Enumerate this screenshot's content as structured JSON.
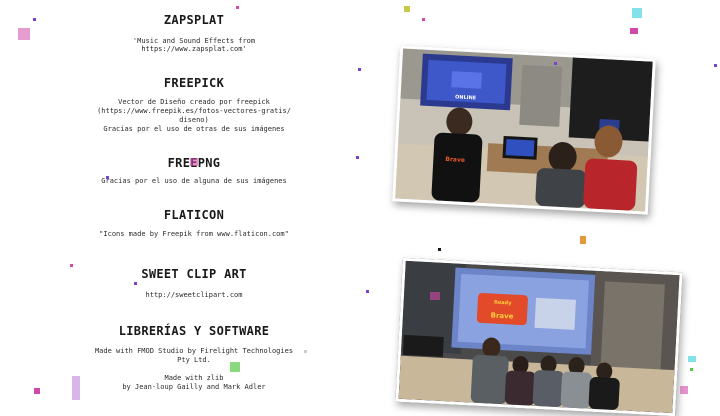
{
  "credits": {
    "zapsplat": {
      "heading": "ZAPSPLAT",
      "lines": [
        "'Music and Sound Effects from",
        "https://www.zapsplat.com'"
      ]
    },
    "freepick": {
      "heading": "FREEPICK",
      "lines": [
        "Vector de Diseño creado por freepick",
        "(https://www.freepik.es/fotos-vectores-gratis/",
        "diseno)",
        "Gracias por el uso de otras de sus imágenes"
      ]
    },
    "freepng": {
      "heading": "FREEPNG",
      "lines": [
        "Gracias por el uso de alguna de sus imágenes"
      ]
    },
    "flaticon": {
      "heading": "FLATICON",
      "lines": [
        "\"Icons made by Freepik from www.flaticon.com\""
      ]
    },
    "sweetclipart": {
      "heading": "SWEET CLIP ART",
      "lines": [
        "http://sweetclipart.com"
      ]
    },
    "libraries": {
      "heading": "LIBRERÍAS Y SOFTWARE",
      "lines": [
        "Made with FMOD Studio by Firelight Technologies",
        "Pty Ltd.",
        "",
        "Made with zlib",
        "by Jean-loup Gailly and Mark Adler"
      ]
    }
  },
  "photos": {
    "top": {
      "screen_text": "ONLINE",
      "shirt_text": "Brave"
    },
    "bottom": {
      "game_logo_top": "Ready",
      "game_logo_bottom": "Brave"
    }
  },
  "colors": {
    "text": "#2b2b2b",
    "heading": "#1a1a1a",
    "pixel_pink": "#d24aa8",
    "pixel_purple": "#7b3fd1",
    "pixel_cyan": "#4fd6e0",
    "pixel_green": "#5bc84a"
  }
}
